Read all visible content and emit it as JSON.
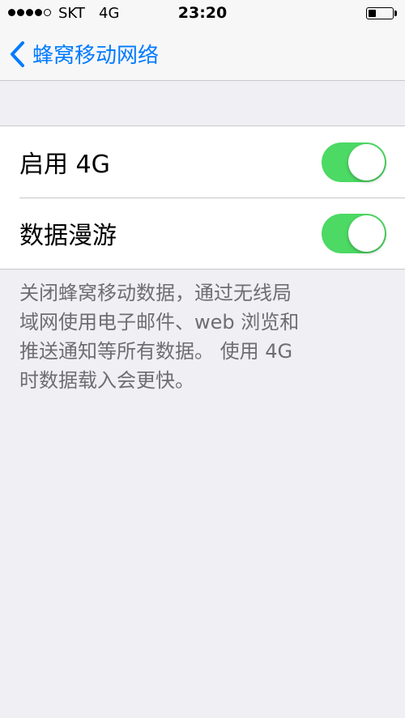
{
  "status_bar": {
    "carrier": "SKT",
    "network": "4G",
    "time": "23:20"
  },
  "nav": {
    "back_label": "蜂窝移动网络",
    "back_icon": "chevron-left-icon"
  },
  "settings": {
    "rows": [
      {
        "label": "启用 4G",
        "enabled": true
      },
      {
        "label": "数据漫游",
        "enabled": true
      }
    ],
    "footer": "关闭蜂窝移动数据，通过无线局\n域网使用电子邮件、web 浏览和\n推送通知等所有数据。 使用 4G\n时数据载入会更快。"
  },
  "colors": {
    "accent": "#007aff",
    "switch_on": "#4cd964",
    "background": "#efeff4",
    "footer_text": "#6d6d72"
  }
}
